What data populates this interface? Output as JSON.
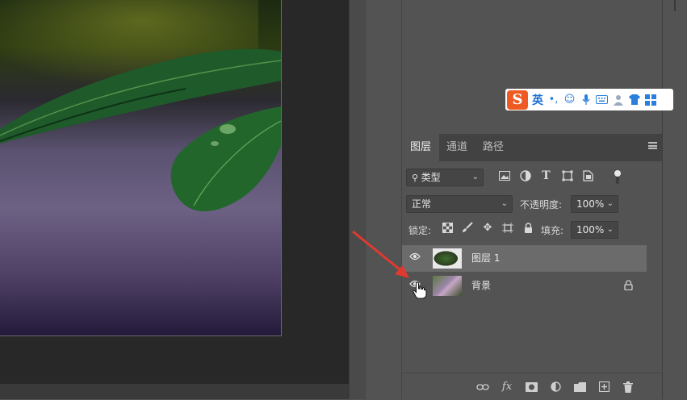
{
  "colors": {
    "accent_arrow": "#e03a2f",
    "ime_logo": "#ef5a24",
    "ime_icons": "#2a7fdc"
  },
  "ime_toolbar": {
    "logo": "S",
    "language": "英",
    "icons": [
      "punctuation-icon",
      "emoji-icon",
      "microphone-icon",
      "keyboard-icon",
      "user-icon",
      "shirt-icon",
      "grid-icon"
    ]
  },
  "layers_panel": {
    "tabs": [
      {
        "label": "图层",
        "active": true
      },
      {
        "label": "通道",
        "active": false
      },
      {
        "label": "路径",
        "active": false
      }
    ],
    "filter": {
      "label": "类型"
    },
    "blend_mode": "正常",
    "opacity": {
      "label": "不透明度:",
      "value": "100%"
    },
    "lock_label": "锁定:",
    "fill": {
      "label": "填充:",
      "value": "100%"
    },
    "layers": [
      {
        "name": "图层 1",
        "selected": true,
        "visible": true,
        "locked": false
      },
      {
        "name": "背景",
        "selected": false,
        "visible": true,
        "locked": true
      }
    ]
  }
}
